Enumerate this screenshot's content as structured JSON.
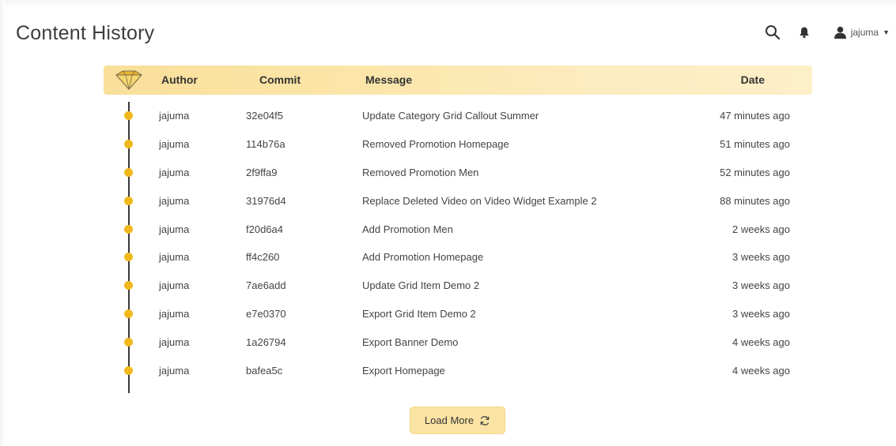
{
  "page": {
    "title": "Content History"
  },
  "header": {
    "search_icon": "search-icon",
    "notifications_icon": "bell-icon",
    "user": {
      "icon": "user-icon",
      "name": "jajuma"
    }
  },
  "table": {
    "columns": {
      "author": "Author",
      "commit": "Commit",
      "message": "Message",
      "date": "Date"
    },
    "rows": [
      {
        "author": "jajuma",
        "commit": "32e04f5",
        "message": "Update Category Grid Callout Summer",
        "date": "47 minutes ago"
      },
      {
        "author": "jajuma",
        "commit": "114b76a",
        "message": "Removed Promotion Homepage",
        "date": "51 minutes ago"
      },
      {
        "author": "jajuma",
        "commit": "2f9ffa9",
        "message": "Removed Promotion Men",
        "date": "52 minutes ago"
      },
      {
        "author": "jajuma",
        "commit": "31976d4",
        "message": "Replace Deleted Video on Video Widget Example 2",
        "date": "88 minutes ago"
      },
      {
        "author": "jajuma",
        "commit": "f20d6a4",
        "message": "Add Promotion Men",
        "date": "2 weeks ago"
      },
      {
        "author": "jajuma",
        "commit": "ff4c260",
        "message": "Add Promotion Homepage",
        "date": "3 weeks ago"
      },
      {
        "author": "jajuma",
        "commit": "7ae6add",
        "message": "Update Grid Item Demo 2",
        "date": "3 weeks ago"
      },
      {
        "author": "jajuma",
        "commit": "e7e0370",
        "message": "Export Grid Item Demo 2",
        "date": "3 weeks ago"
      },
      {
        "author": "jajuma",
        "commit": "1a26794",
        "message": "Export Banner Demo",
        "date": "4 weeks ago"
      },
      {
        "author": "jajuma",
        "commit": "bafea5c",
        "message": "Export Homepage",
        "date": "4 weeks ago"
      }
    ]
  },
  "load_more": {
    "label": "Load More",
    "icon": "refresh-icon"
  },
  "colors": {
    "accent": "#f1b81d",
    "header_bg": "#fbe5a8",
    "button_bg": "#fbe4a3",
    "timeline": "#3a3a3a"
  }
}
